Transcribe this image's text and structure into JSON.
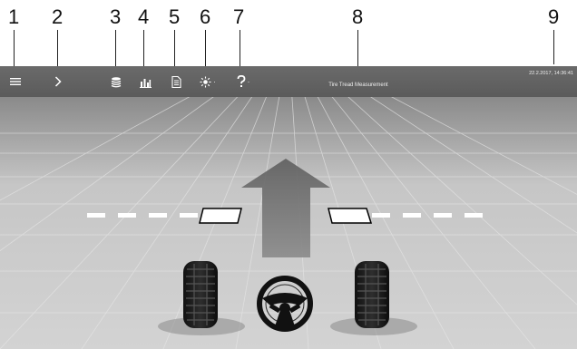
{
  "callouts": [
    "1",
    "2",
    "3",
    "4",
    "5",
    "6",
    "7",
    "8",
    "9"
  ],
  "toolbar": {
    "title": "Tire Tread Measurement",
    "datetime": "22.2.2017, 14:36:41",
    "icons": [
      "menu-icon",
      "chevron-right-icon",
      "layers-icon",
      "bar-chart-icon",
      "document-icon",
      "brightness-icon",
      "help-icon"
    ]
  },
  "colors": {
    "toolbar": "#5f5f5f",
    "arrow": "#6b6b6b",
    "floor": "#cfcfcf",
    "dash": "#ffffff"
  }
}
